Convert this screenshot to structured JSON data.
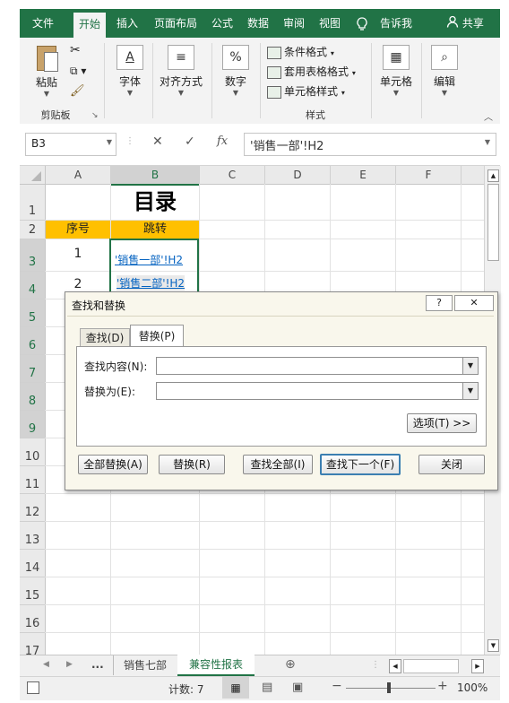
{
  "ribbon_tabs": [
    "文件",
    "开始",
    "插入",
    "页面布局",
    "公式",
    "数据",
    "审阅",
    "视图"
  ],
  "tell_me": "告诉我",
  "share": "共享",
  "ribbon": {
    "paste": "粘贴",
    "clipboard": "剪贴板",
    "font": "字体",
    "alignment": "对齐方式",
    "number": "数字",
    "number_icon": "%",
    "conditional_format": "条件格式",
    "format_as_table": "套用表格格式",
    "cell_styles": "单元格样式",
    "styles": "样式",
    "cells": "单元格",
    "editing": "编辑"
  },
  "formula_bar": {
    "name_box": "B3",
    "cancel": "✕",
    "enter": "✓",
    "fx": "fx",
    "content": "'销售一部'!H2"
  },
  "columns": [
    "A",
    "B",
    "C",
    "D",
    "E",
    "F"
  ],
  "rows": [
    "1",
    "2",
    "3",
    "4",
    "5",
    "6",
    "7",
    "8",
    "9",
    "10",
    "11",
    "12",
    "13",
    "14",
    "15",
    "16",
    "17"
  ],
  "cells": {
    "title": "目录",
    "header_seq": "序号",
    "header_jump": "跳转",
    "r3_seq": "1",
    "r3_link": "'销售一部'!H2",
    "r4_seq": "2",
    "r4_link": "'销售二部'!H2"
  },
  "sheet_tabs": {
    "ellipsis": "...",
    "tab1": "销售七部",
    "tab2": "兼容性报表"
  },
  "status": {
    "count": "计数: 7",
    "zoom": "100%"
  },
  "dialog": {
    "title": "查找和替换",
    "help": "?",
    "tab_find": "查找(D)",
    "tab_replace": "替换(P)",
    "find_label": "查找内容(N):",
    "find_value": "",
    "replace_label": "替换为(E):",
    "replace_value": "",
    "options_btn": "选项(T) >>",
    "replace_all_btn": "全部替换(A)",
    "replace_btn": "替换(R)",
    "find_all_btn": "查找全部(I)",
    "find_next_btn": "查找下一个(F)",
    "close_btn": "关闭"
  },
  "colors": {
    "brand": "#217346",
    "header_fill": "#ffc000",
    "link": "#0563c1",
    "dialog_bg": "#f9f7ec"
  }
}
